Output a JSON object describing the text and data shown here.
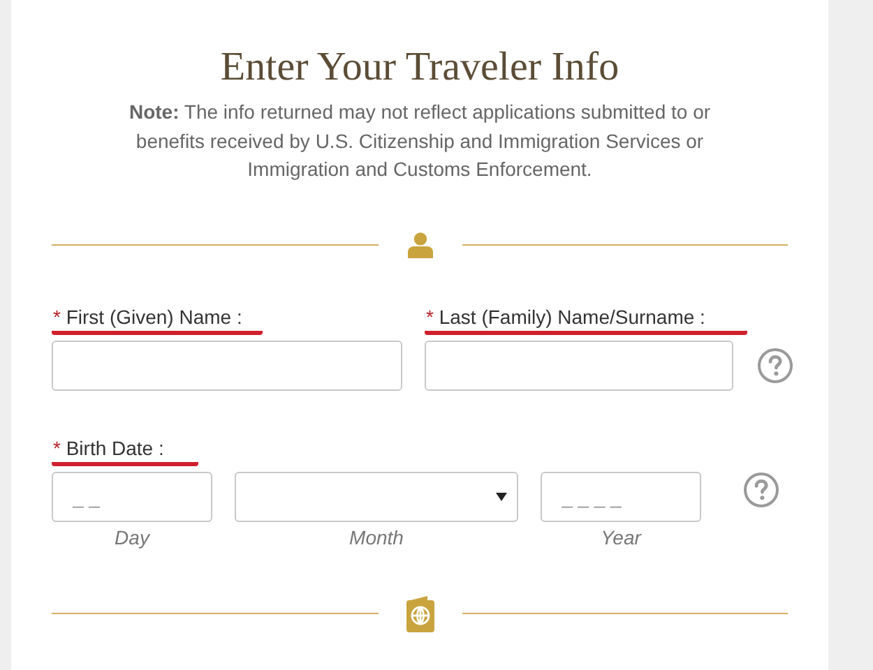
{
  "title": "Enter Your Traveler Info",
  "note": "**Note:** The info returned may not reflect applications submitted to or benefits received by U.S. Citizenship and Immigration Services or Immigration and Customs Enforcement.",
  "name_fields": [
    {
      "marker": "*",
      "label": "First (Given) Name :",
      "underlined": true,
      "help": false
    },
    {
      "marker": "*",
      "label": "Last (Family) Name/Surname :",
      "underlined": true,
      "help": true
    }
  ],
  "birth_date": {
    "marker": "*",
    "label": "Birth Date :",
    "underlined": true,
    "help": true,
    "parts": [
      {
        "kind": "text",
        "placeholder": "_ _",
        "caption": "Day"
      },
      {
        "kind": "select",
        "caption": "Month"
      },
      {
        "kind": "text",
        "placeholder": "_ _ _ _",
        "caption": "Year"
      }
    ]
  }
}
